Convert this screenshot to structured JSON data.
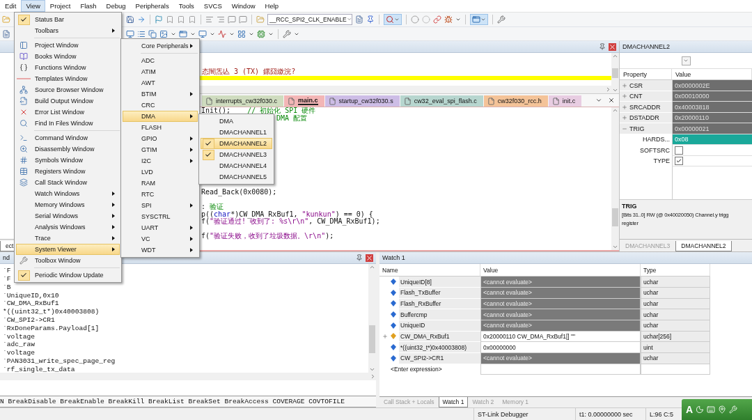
{
  "menubar": [
    {
      "label": "Edit",
      "selected": false
    },
    {
      "label": "View",
      "selected": true
    },
    {
      "label": "Project",
      "selected": false
    },
    {
      "label": "Flash",
      "selected": false
    },
    {
      "label": "Debug",
      "selected": false
    },
    {
      "label": "Peripherals",
      "selected": false
    },
    {
      "label": "Tools",
      "selected": false
    },
    {
      "label": "SVCS",
      "selected": false
    },
    {
      "label": "Window",
      "selected": false
    },
    {
      "label": "Help",
      "selected": false
    }
  ],
  "toolbar": {
    "combo": "__RCC_SPI2_CLK_ENABLE"
  },
  "view_menu": {
    "items": [
      {
        "kind": "item",
        "label": "Status Bar",
        "checked": true,
        "submenu": false,
        "selected": false
      },
      {
        "kind": "item",
        "label": "Toolbars",
        "checked": false,
        "submenu": true,
        "selected": false
      },
      {
        "kind": "separator"
      },
      {
        "kind": "item",
        "label": "Project Window",
        "checked": false,
        "submenu": false,
        "selected": false
      },
      {
        "kind": "item",
        "label": "Books Window",
        "checked": false,
        "submenu": false,
        "selected": false
      },
      {
        "kind": "item",
        "label": "Functions Window",
        "checked": false,
        "submenu": false,
        "selected": false
      },
      {
        "kind": "item",
        "label": "Templates Window",
        "checked": false,
        "submenu": false,
        "selected": false
      },
      {
        "kind": "item",
        "label": "Source Browser Window",
        "checked": false,
        "submenu": false,
        "selected": false
      },
      {
        "kind": "item",
        "label": "Build Output Window",
        "checked": false,
        "submenu": false,
        "selected": false
      },
      {
        "kind": "item",
        "label": "Error List Window",
        "checked": false,
        "submenu": false,
        "selected": false
      },
      {
        "kind": "item",
        "label": "Find In Files Window",
        "checked": false,
        "submenu": false,
        "selected": false
      },
      {
        "kind": "separator"
      },
      {
        "kind": "item",
        "label": "Command Window",
        "checked": false,
        "submenu": false,
        "selected": false
      },
      {
        "kind": "item",
        "label": "Disassembly Window",
        "checked": false,
        "submenu": false,
        "selected": false
      },
      {
        "kind": "item",
        "label": "Symbols Window",
        "checked": false,
        "submenu": false,
        "selected": false
      },
      {
        "kind": "item",
        "label": "Registers Window",
        "checked": false,
        "submenu": false,
        "selected": false
      },
      {
        "kind": "item",
        "label": "Call Stack Window",
        "checked": false,
        "submenu": false,
        "selected": false
      },
      {
        "kind": "item",
        "label": "Watch Windows",
        "checked": false,
        "submenu": true,
        "selected": false
      },
      {
        "kind": "item",
        "label": "Memory Windows",
        "checked": false,
        "submenu": true,
        "selected": false
      },
      {
        "kind": "item",
        "label": "Serial Windows",
        "checked": false,
        "submenu": true,
        "selected": false
      },
      {
        "kind": "item",
        "label": "Analysis Windows",
        "checked": false,
        "submenu": true,
        "selected": false
      },
      {
        "kind": "item",
        "label": "Trace",
        "checked": false,
        "submenu": true,
        "selected": false
      },
      {
        "kind": "item",
        "label": "System Viewer",
        "checked": false,
        "submenu": true,
        "selected": true
      },
      {
        "kind": "item",
        "label": "Toolbox Window",
        "checked": false,
        "submenu": false,
        "selected": false
      },
      {
        "kind": "separator"
      },
      {
        "kind": "item",
        "label": "Periodic Window Update",
        "checked": true,
        "submenu": false,
        "selected": false
      }
    ]
  },
  "system_viewer_menu": {
    "items": [
      {
        "kind": "item",
        "label": "Core Peripherals",
        "checked": false,
        "submenu": true,
        "selected": false
      },
      {
        "kind": "separator"
      },
      {
        "kind": "item",
        "label": "ADC",
        "checked": false,
        "submenu": false,
        "selected": false
      },
      {
        "kind": "item",
        "label": "ATIM",
        "checked": false,
        "submenu": false,
        "selected": false
      },
      {
        "kind": "item",
        "label": "AWT",
        "checked": false,
        "submenu": false,
        "selected": false
      },
      {
        "kind": "item",
        "label": "BTIM",
        "checked": false,
        "submenu": true,
        "selected": false
      },
      {
        "kind": "item",
        "label": "CRC",
        "checked": false,
        "submenu": false,
        "selected": false
      },
      {
        "kind": "item",
        "label": "DMA",
        "checked": false,
        "submenu": true,
        "selected": true
      },
      {
        "kind": "item",
        "label": "FLASH",
        "checked": false,
        "submenu": false,
        "selected": false
      },
      {
        "kind": "item",
        "label": "GPIO",
        "checked": false,
        "submenu": true,
        "selected": false
      },
      {
        "kind": "item",
        "label": "GTIM",
        "checked": false,
        "submenu": true,
        "selected": false
      },
      {
        "kind": "item",
        "label": "I2C",
        "checked": false,
        "submenu": true,
        "selected": false
      },
      {
        "kind": "item",
        "label": "LVD",
        "checked": false,
        "submenu": false,
        "selected": false
      },
      {
        "kind": "item",
        "label": "RAM",
        "checked": false,
        "submenu": false,
        "selected": false
      },
      {
        "kind": "item",
        "label": "RTC",
        "checked": false,
        "submenu": false,
        "selected": false
      },
      {
        "kind": "item",
        "label": "SPI",
        "checked": false,
        "submenu": true,
        "selected": false
      },
      {
        "kind": "item",
        "label": "SYSCTRL",
        "checked": false,
        "submenu": false,
        "selected": false
      },
      {
        "kind": "item",
        "label": "UART",
        "checked": false,
        "submenu": true,
        "selected": false
      },
      {
        "kind": "item",
        "label": "VC",
        "checked": false,
        "submenu": true,
        "selected": false
      },
      {
        "kind": "item",
        "label": "WDT",
        "checked": false,
        "submenu": true,
        "selected": false
      }
    ]
  },
  "dma_menu": {
    "items": [
      {
        "kind": "item",
        "label": "DMA",
        "checked": false,
        "submenu": false,
        "selected": false
      },
      {
        "kind": "item",
        "label": "DMACHANNEL1",
        "checked": false,
        "submenu": false,
        "selected": false
      },
      {
        "kind": "item",
        "label": "DMACHANNEL2",
        "checked": true,
        "submenu": false,
        "selected": true
      },
      {
        "kind": "item",
        "label": "DMACHANNEL3",
        "checked": true,
        "submenu": false,
        "selected": false
      },
      {
        "kind": "item",
        "label": "DMACHANNEL4",
        "checked": false,
        "submenu": false,
        "selected": false
      },
      {
        "kind": "item",
        "label": "DMACHANNEL5",
        "checked": false,
        "submenu": false,
        "selected": false
      }
    ]
  },
  "project_panel": {
    "tab": "ect"
  },
  "disassembly": {
    "text": "态闇炁亾 3 (TX) 鏍囧繳浣?",
    "current_line_highlighted": true
  },
  "editor_tabs": [
    {
      "label": "interrupts_cw32f030.c",
      "color": "#cfdcbf",
      "selected": false
    },
    {
      "label": "main.c",
      "color": "#f3b6b6",
      "selected": true
    },
    {
      "label": "startup_cw32f030.s",
      "color": "#cdbde6",
      "selected": false
    },
    {
      "label": "cw32_eval_spi_flash.c",
      "color": "#b7d6cf",
      "selected": false
    },
    {
      "label": "cw32f030_rcc.h",
      "color": "#f4c398",
      "selected": false
    },
    {
      "label": "init.c",
      "color": "#e8cde2",
      "selected": false
    }
  ],
  "code_lines": [
    {
      "kind": "full",
      "segments": [
        {
          "text": "Init();    ",
          "kind": "plain"
        },
        {
          "text": "// 初始化 SPI 硬件",
          "kind": "comment"
        }
      ]
    },
    {
      "kind": "cut",
      "segments": [
        {
          "text": "DMA 配置",
          "kind": "comment"
        }
      ]
    },
    {
      "kind": "blank"
    },
    {
      "kind": "blank"
    },
    {
      "kind": "blank"
    },
    {
      "kind": "blank"
    },
    {
      "kind": "blank"
    },
    {
      "kind": "blank"
    },
    {
      "kind": "blank"
    },
    {
      "kind": "blank"
    },
    {
      "kind": "blank"
    },
    {
      "kind": "full",
      "segments": [
        {
          "text": "Read_Back(0x0080);",
          "kind": "plain"
        }
      ]
    },
    {
      "kind": "blank"
    },
    {
      "kind": "full",
      "segments": [
        {
          "text": ": ",
          "kind": "plain"
        },
        {
          "text": "验证",
          "kind": "comment"
        }
      ]
    },
    {
      "kind": "full",
      "segments": [
        {
          "text": "p((",
          "kind": "plain"
        },
        {
          "text": "char",
          "kind": "keyword"
        },
        {
          "text": "*)CW_DMA_RxBuf1, ",
          "kind": "plain"
        },
        {
          "text": "\"kunkun\"",
          "kind": "string"
        },
        {
          "text": ") == 0) {",
          "kind": "plain"
        }
      ]
    },
    {
      "kind": "full",
      "segments": [
        {
          "text": "f(",
          "kind": "plain"
        },
        {
          "text": "\"验证通过! 收到了: %s\\r\\n\"",
          "kind": "string"
        },
        {
          "text": ", CW_DMA_RxBuf1);",
          "kind": "plain"
        }
      ]
    },
    {
      "kind": "blank"
    },
    {
      "kind": "full",
      "segments": [
        {
          "text": "f(",
          "kind": "plain"
        },
        {
          "text": "\"验证失败，收到了垃圾数据。\\r\\n\"",
          "kind": "string"
        },
        {
          "text": ");",
          "kind": "plain"
        }
      ]
    }
  ],
  "register_panel": {
    "title": "DMACHANNEL2",
    "columns": [
      "Property",
      "Value"
    ],
    "rows": [
      {
        "name": "CSR",
        "value": "0x0000002E",
        "expanded": false,
        "selected": false
      },
      {
        "name": "CNT",
        "value": "0x00010000",
        "expanded": false,
        "selected": false
      },
      {
        "name": "SRCADDR",
        "value": "0x40003818",
        "expanded": false,
        "selected": false
      },
      {
        "name": "DSTADDR",
        "value": "0x20000110",
        "expanded": false,
        "selected": false
      },
      {
        "name": "TRIG",
        "value": "0x00000021",
        "expanded": true,
        "selected": false,
        "children": [
          {
            "kind": "field",
            "name": "HARDS...",
            "value": "0x08",
            "selected": true
          },
          {
            "kind": "flag",
            "name": "SOFTSRC",
            "checked": false,
            "selected": false
          },
          {
            "kind": "flag",
            "name": "TYPE",
            "checked": true,
            "selected": false
          }
        ]
      }
    ],
    "description": {
      "title": "TRIG",
      "lines": [
        "[Bits 31..0] RW (@ 0x40020050) Channel.y trigg",
        "register"
      ]
    },
    "tabs": [
      {
        "label": "DMACHANNEL3",
        "selected": false
      },
      {
        "label": "DMACHANNEL2",
        "selected": true
      }
    ]
  },
  "command_panel": {
    "title": "nd",
    "lines": [
      "`F",
      "`F",
      "`B",
      "`UniqueID,0x10",
      "`CW_DMA_RxBuf1",
      "*((uint32_t*)0x40003808)",
      "`CW_SPI2->CR1",
      "`RxDoneParams.Payload[1]",
      "`voltage",
      "`adc_raw",
      "`voltage",
      "`PAN3031_write_spec_page_reg",
      "`rf_single_tx_data"
    ],
    "command_line": "N BreakDisable BreakEnable BreakKill BreakList BreakSet BreakAccess COVERAGE COVTOFILE"
  },
  "watch_panel": {
    "title": "Watch 1",
    "columns": [
      "Name",
      "Value",
      "Type"
    ],
    "rows": [
      {
        "name": "UniqueID[8]",
        "value": "<cannot evaluate>",
        "type": "uchar",
        "kind": "error",
        "expandable": false
      },
      {
        "name": "Flash_TxBuffer",
        "value": "<cannot evaluate>",
        "type": "uchar",
        "kind": "error",
        "expandable": false
      },
      {
        "name": "Flash_RxBuffer",
        "value": "<cannot evaluate>",
        "type": "uchar",
        "kind": "error",
        "expandable": false
      },
      {
        "name": "Buffercmp",
        "value": "<cannot evaluate>",
        "type": "uchar",
        "kind": "error",
        "expandable": false
      },
      {
        "name": "UniqueID",
        "value": "<cannot evaluate>",
        "type": "uchar",
        "kind": "error",
        "expandable": false
      },
      {
        "name": "CW_DMA_RxBuf1",
        "value": "0x20000110 CW_DMA_RxBuf1[] \"\"",
        "type": "uchar[256]",
        "kind": "ok",
        "expandable": true
      },
      {
        "name": "*((uint32_t*)0x40003808)",
        "value": "0x00000000",
        "type": "uint",
        "kind": "ok",
        "expandable": false
      },
      {
        "name": "CW_SPI2->CR1",
        "value": "<cannot evaluate>",
        "type": "uchar",
        "kind": "error",
        "expandable": false
      }
    ],
    "placeholder": "<Enter expression>",
    "tabs": [
      {
        "label": "Call Stack + Locals",
        "selected": false
      },
      {
        "label": "Watch 1",
        "selected": true
      },
      {
        "label": "Watch 2",
        "selected": false
      },
      {
        "label": "Memory 1",
        "selected": false
      }
    ]
  },
  "status_bar": [
    "ST-Link Debugger",
    "t1: 0.00000000 sec",
    "L:96 C:5"
  ],
  "ime_bar": {
    "label": "A"
  }
}
